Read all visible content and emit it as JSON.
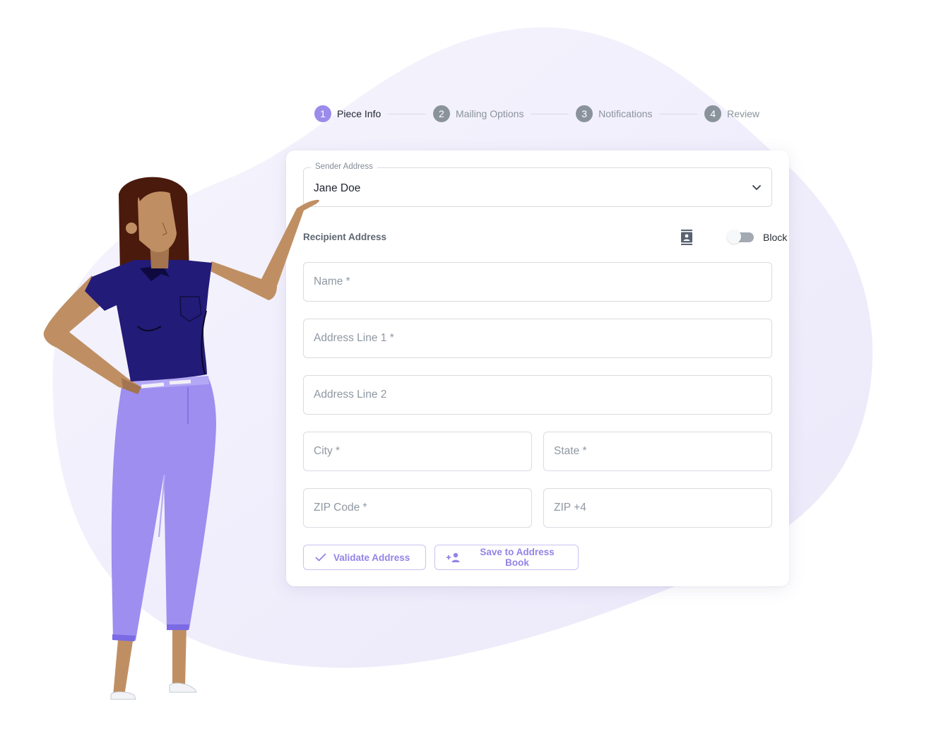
{
  "stepper": {
    "steps": [
      {
        "number": "1",
        "label": "Piece Info",
        "active": true
      },
      {
        "number": "2",
        "label": "Mailing Options",
        "active": false
      },
      {
        "number": "3",
        "label": "Notifications",
        "active": false
      },
      {
        "number": "4",
        "label": "Review",
        "active": false
      }
    ]
  },
  "sender": {
    "legend": "Sender Address",
    "value": "Jane Doe",
    "icon": "chevron-down-icon"
  },
  "recipient": {
    "label": "Recipient Address",
    "address_book_icon": "contact-book-icon",
    "toggle_label": "Block",
    "toggle_on": false
  },
  "fields": {
    "name": {
      "placeholder": "Name *",
      "value": ""
    },
    "address1": {
      "placeholder": "Address Line 1 *",
      "value": ""
    },
    "address2": {
      "placeholder": "Address Line 2",
      "value": ""
    },
    "city": {
      "placeholder": "City *",
      "value": ""
    },
    "state": {
      "placeholder": "State *",
      "value": ""
    },
    "zip": {
      "placeholder": "ZIP Code *",
      "value": ""
    },
    "zip4": {
      "placeholder": "ZIP +4",
      "value": ""
    }
  },
  "actions": {
    "validate_label": "Validate Address",
    "validate_icon": "check-icon",
    "save_label": "Save to Address Book",
    "save_icon": "add-person-icon"
  },
  "colors": {
    "accent": "#9b8bea",
    "blob": "#efedfb",
    "shirt": "#231b78",
    "pants": "#9d8ef0",
    "skin": "#bf8f63",
    "hair": "#4a1a0c"
  }
}
